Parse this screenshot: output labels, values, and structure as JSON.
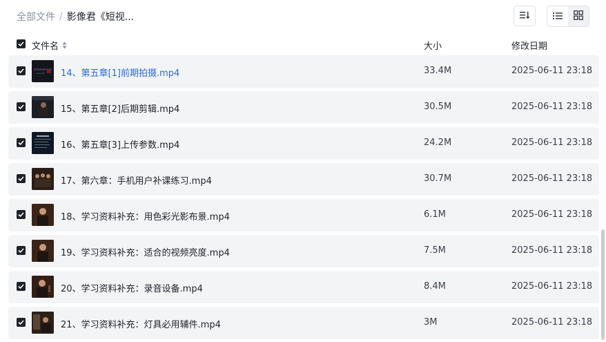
{
  "breadcrumb": {
    "root": "全部文件",
    "separator": "/",
    "current": "影像君《短视..."
  },
  "toolbar": {
    "sort_icon": "sort-icon",
    "list_view_icon": "list-view-icon",
    "grid_view_icon": "grid-view-icon"
  },
  "header": {
    "name": "文件名",
    "size": "大小",
    "date": "修改日期"
  },
  "files": [
    {
      "name": "14、第五章[1]前期拍摄.mp4",
      "size": "33.4M",
      "date": "2025-06-11 23:18",
      "highlighted": true
    },
    {
      "name": "15、第五章[2]后期剪辑.mp4",
      "size": "30.5M",
      "date": "2025-06-11 23:18",
      "highlighted": false
    },
    {
      "name": "16、第五章[3]上传参数.mp4",
      "size": "24.2M",
      "date": "2025-06-11 23:18",
      "highlighted": false
    },
    {
      "name": "17、第六章：手机用户补课练习.mp4",
      "size": "30.7M",
      "date": "2025-06-11 23:18",
      "highlighted": false
    },
    {
      "name": "18、学习资料补充：用色彩光影布景.mp4",
      "size": "6.1M",
      "date": "2025-06-11 23:18",
      "highlighted": false
    },
    {
      "name": "19、学习资料补充：适合的视频亮度.mp4",
      "size": "7.5M",
      "date": "2025-06-11 23:18",
      "highlighted": false
    },
    {
      "name": "20、学习资料补充：录音设备.mp4",
      "size": "8.4M",
      "date": "2025-06-11 23:18",
      "highlighted": false
    },
    {
      "name": "21、学习资料补充：灯具必用辅件.mp4",
      "size": "3M",
      "date": "2025-06-11 23:18",
      "highlighted": false
    }
  ],
  "colors": {
    "link": "#2a6ae0",
    "row_bg": "#f3f4f6",
    "checkbox": "#1f2329"
  }
}
